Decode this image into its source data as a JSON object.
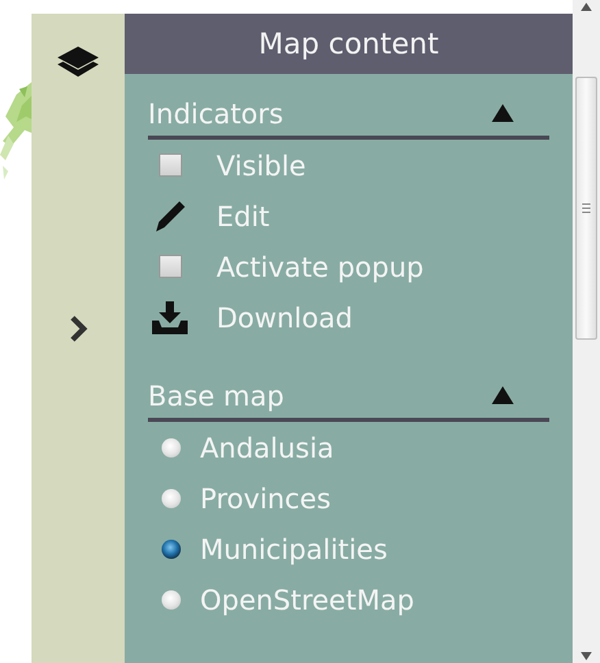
{
  "sidebar": {
    "items": [
      {
        "kind": "layers"
      },
      {
        "kind": "expand"
      }
    ]
  },
  "panel": {
    "title": "Map content",
    "sections": [
      {
        "title": "Indicators",
        "expanded": true,
        "items": [
          {
            "kind": "checkbox",
            "label": "Visible",
            "checked": false
          },
          {
            "kind": "edit",
            "label": "Edit"
          },
          {
            "kind": "checkbox",
            "label": "Activate popup",
            "checked": false
          },
          {
            "kind": "download",
            "label": "Download"
          }
        ]
      },
      {
        "title": "Base map",
        "expanded": true,
        "items": [
          {
            "kind": "radio",
            "label": "Andalusia",
            "selected": false
          },
          {
            "kind": "radio",
            "label": "Provinces",
            "selected": false
          },
          {
            "kind": "radio",
            "label": "Municipalities",
            "selected": true
          },
          {
            "kind": "radio",
            "label": "OpenStreetMap",
            "selected": false
          }
        ]
      }
    ]
  }
}
